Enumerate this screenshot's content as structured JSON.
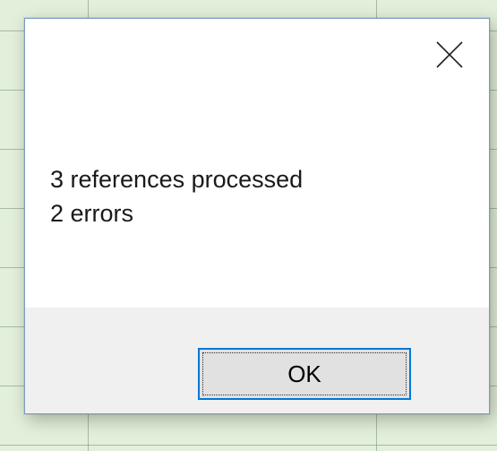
{
  "dialog": {
    "message_lines": [
      "3 references processed",
      "2 errors"
    ],
    "close_icon": "close-x-icon",
    "ok_label": "OK"
  },
  "colors": {
    "sheet_background": "#e2efda",
    "dialog_background": "#ffffff",
    "button_bar_background": "#f0f0f0",
    "button_background": "#e1e1e1",
    "button_focus_border": "#0078d7"
  }
}
